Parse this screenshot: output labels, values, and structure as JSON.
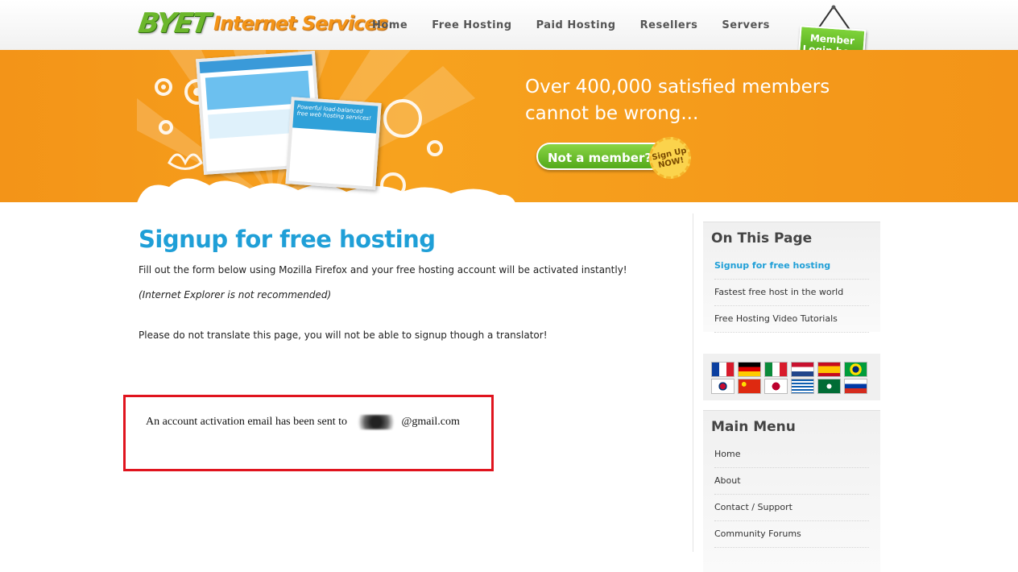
{
  "header": {
    "logo_byet": "BYET",
    "logo_services": "Internet Services",
    "nav": [
      "Home",
      "Free Hosting",
      "Paid Hosting",
      "Resellers",
      "Servers"
    ],
    "member_login": "Member Login here"
  },
  "banner": {
    "tagline_line1": "Over 400,000 satisfied members",
    "tagline_line2": "cannot be wrong...",
    "not_member": "Not a member?",
    "signup_badge": "Sign Up NOW!",
    "screen_text": "Powerful load-balanced free web hosting services!"
  },
  "main": {
    "title": "Signup for free hosting",
    "intro": "Fill out the form below using Mozilla Firefox and your free hosting account will be activated instantly!",
    "ie_note": "(Internet Explorer is not recommended)",
    "translate_note": "Please do not translate this page, you will not be able to signup though a translator!",
    "activation_prefix": "An account activation email has been sent to",
    "activation_suffix": "@gmail.com"
  },
  "sidebar": {
    "on_this_page_title": "On This Page",
    "on_this_page": [
      "Signup for free hosting",
      "Fastest free host in the world",
      "Free Hosting Video Tutorials"
    ],
    "main_menu_title": "Main Menu",
    "main_menu": [
      "Home",
      "About",
      "Contact / Support",
      "Community Forums"
    ],
    "flags": [
      "france",
      "germany",
      "italy",
      "netherlands",
      "spain",
      "brazil",
      "korea",
      "china",
      "japan",
      "greece",
      "saudi-arabia",
      "russia"
    ]
  },
  "colors": {
    "accent_blue": "#1f9fd7",
    "banner_orange": "#f39418",
    "green": "#6cb72c",
    "highlight_red": "#e0141e"
  }
}
